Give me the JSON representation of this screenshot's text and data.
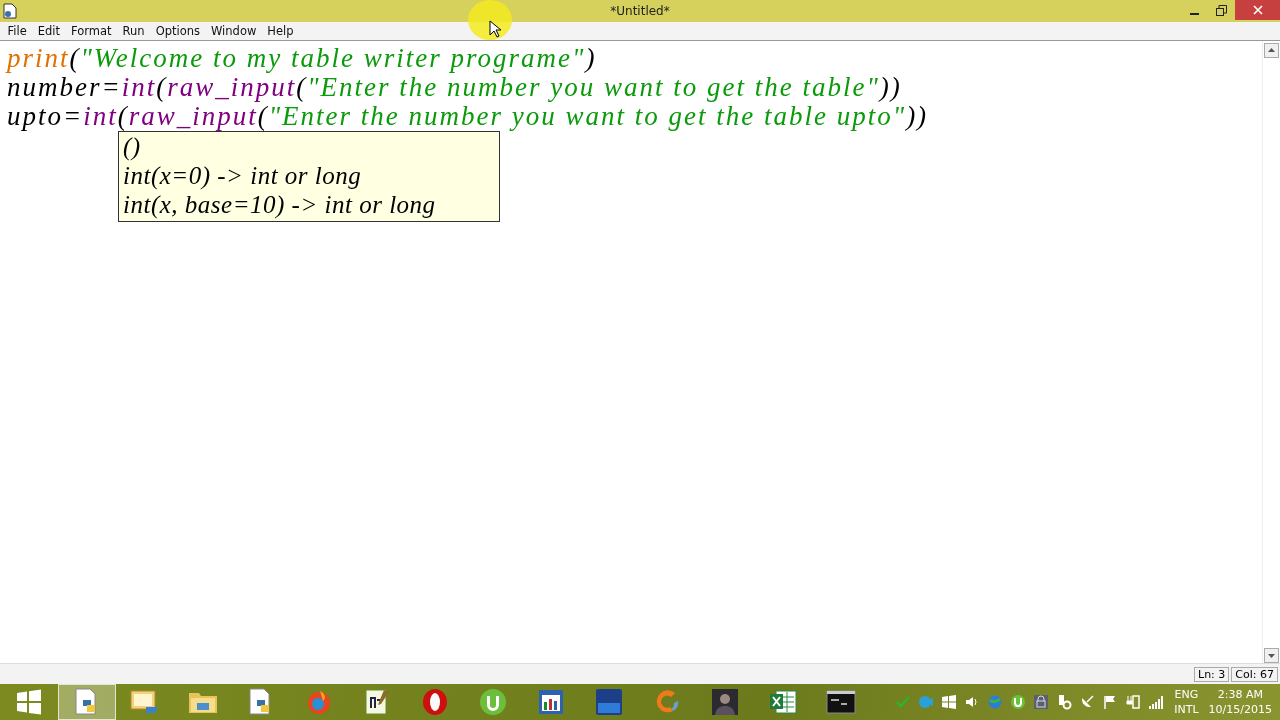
{
  "window": {
    "title": "*Untitled*"
  },
  "menu": [
    "File",
    "Edit",
    "Format",
    "Run",
    "Options",
    "Window",
    "Help"
  ],
  "code_lines": [
    [
      {
        "kind": "keyword",
        "text": "print"
      },
      {
        "kind": "plain",
        "text": "("
      },
      {
        "kind": "string",
        "text": "\"Welcome to my table writer programe\""
      },
      {
        "kind": "plain",
        "text": ")"
      }
    ],
    [
      {
        "kind": "plain",
        "text": "number="
      },
      {
        "kind": "builtin",
        "text": "int"
      },
      {
        "kind": "plain",
        "text": "("
      },
      {
        "kind": "builtin",
        "text": "raw_input"
      },
      {
        "kind": "plain",
        "text": "("
      },
      {
        "kind": "string",
        "text": "\"Enter the number you want to get the table\""
      },
      {
        "kind": "plain",
        "text": "))"
      }
    ],
    [
      {
        "kind": "plain",
        "text": "upto="
      },
      {
        "kind": "builtin",
        "text": "int"
      },
      {
        "kind": "plain",
        "text": "("
      },
      {
        "kind": "builtin",
        "text": "raw_input"
      },
      {
        "kind": "plain",
        "text": "("
      },
      {
        "kind": "string",
        "text": "\"Enter the number you want to get the table upto\""
      },
      {
        "kind": "plain",
        "text": "))"
      }
    ]
  ],
  "calltip": [
    "()",
    "int(x=0) -> int or long",
    "int(x, base=10) -> int or long"
  ],
  "status_bar": {
    "line": "Ln: 3",
    "column": "Col: 67"
  },
  "taskbar": {
    "apps": [
      {
        "kind": "start",
        "selected": false
      },
      {
        "kind": "python",
        "selected": true
      },
      {
        "kind": "tool",
        "selected": false
      },
      {
        "kind": "folder",
        "selected": false
      },
      {
        "kind": "python",
        "selected": false
      },
      {
        "kind": "browser",
        "selected": false
      },
      {
        "kind": "notepad",
        "selected": false
      },
      {
        "kind": "opera",
        "selected": false
      },
      {
        "kind": "torrent",
        "selected": false
      },
      {
        "kind": "chart",
        "selected": false
      },
      {
        "kind": "ide",
        "selected": false
      },
      {
        "kind": "swirl",
        "selected": false
      },
      {
        "kind": "portrait",
        "selected": false
      },
      {
        "kind": "excel",
        "selected": false
      },
      {
        "kind": "terminal",
        "selected": false
      }
    ],
    "language": [
      "ENG",
      "INTL"
    ],
    "time": "2:38 AM",
    "date": "10/15/2015"
  }
}
